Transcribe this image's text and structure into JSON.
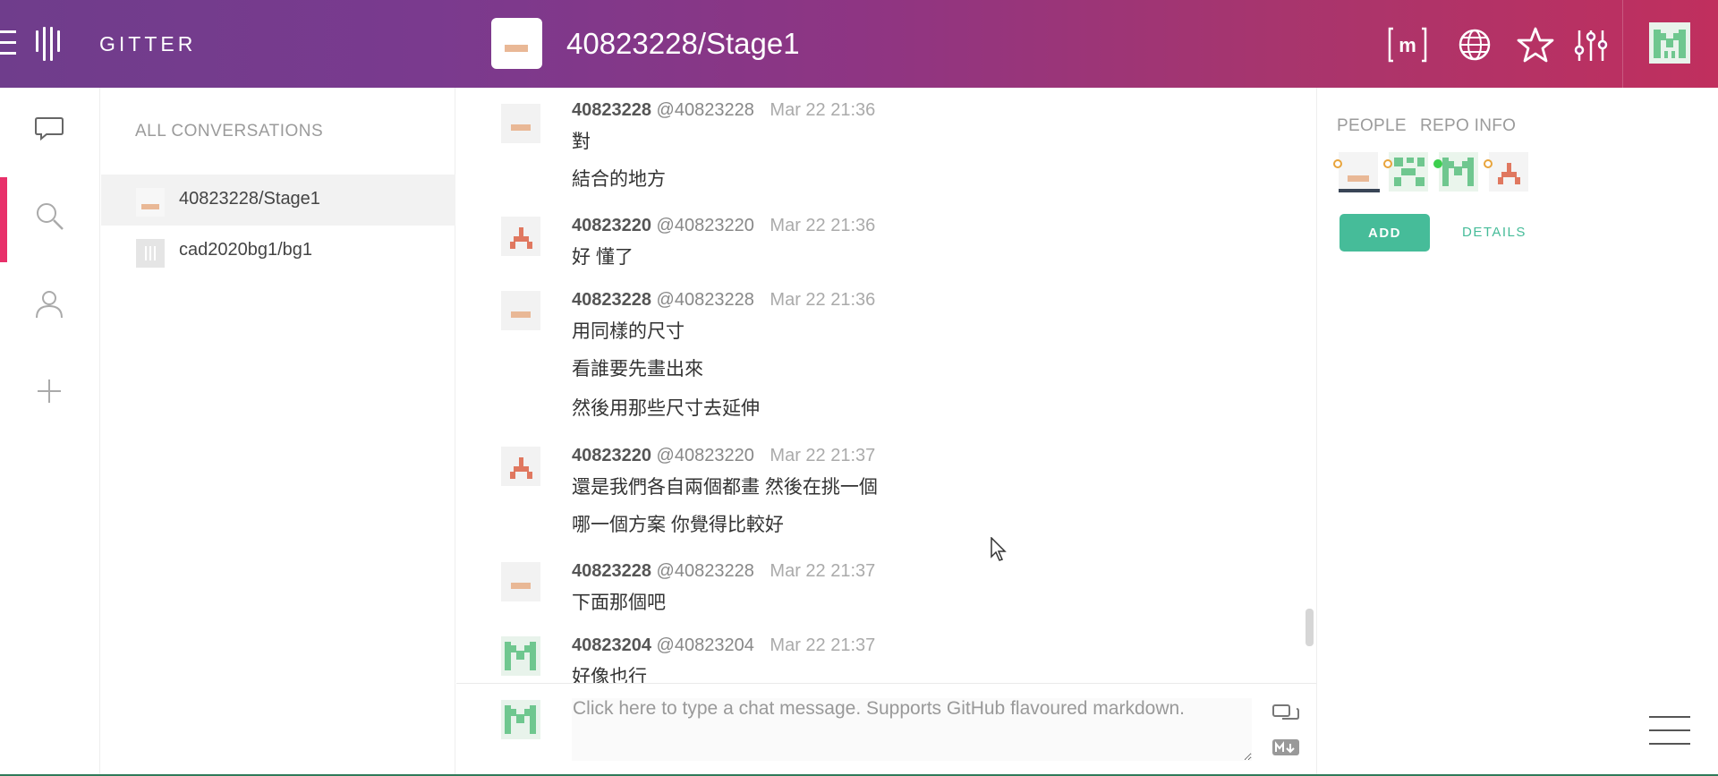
{
  "header": {
    "brand": "GITTER",
    "room_title": "40823228/Stage1",
    "icons": [
      "menu-icon",
      "gitter-logo-icon",
      "matrix-icon",
      "globe-icon",
      "star-icon",
      "settings-sliders-icon",
      "user-avatar"
    ]
  },
  "rail": {
    "icons": [
      "chat-icon",
      "search-icon",
      "person-icon",
      "plus-icon"
    ],
    "accent": "#e8306a"
  },
  "conversations": {
    "title": "ALL CONVERSATIONS",
    "items": [
      {
        "label": "40823228/Stage1",
        "active": true
      },
      {
        "label": "cad2020bg1/bg1",
        "active": false
      }
    ]
  },
  "messages": [
    {
      "name": "40823228",
      "user": "@40823228",
      "time": "Mar 22 21:36",
      "lines": [
        "對",
        "結合的地方"
      ]
    },
    {
      "name": "40823220",
      "user": "@40823220",
      "time": "Mar 22 21:36",
      "lines": [
        "好 懂了"
      ]
    },
    {
      "name": "40823228",
      "user": "@40823228",
      "time": "Mar 22 21:36",
      "lines": [
        "用同樣的尺寸",
        "看誰要先畫出來",
        "然後用那些尺寸去延伸"
      ]
    },
    {
      "name": "40823220",
      "user": "@40823220",
      "time": "Mar 22 21:37",
      "lines": [
        "還是我們各自兩個都畫 然後在挑一個",
        "哪一個方案 你覺得比較好"
      ]
    },
    {
      "name": "40823228",
      "user": "@40823228",
      "time": "Mar 22 21:37",
      "lines": [
        "下面那個吧"
      ]
    },
    {
      "name": "40823204",
      "user": "@40823204",
      "time": "Mar 22 21:37",
      "lines": [
        "好像也行"
      ]
    }
  ],
  "input": {
    "placeholder": "Click here to type a chat message. Supports GitHub flavoured markdown."
  },
  "right_panel": {
    "tabs": [
      "PEOPLE",
      "REPO INFO"
    ],
    "add_label": "ADD",
    "details_label": "DETAILS",
    "accent": "#46bc99"
  }
}
